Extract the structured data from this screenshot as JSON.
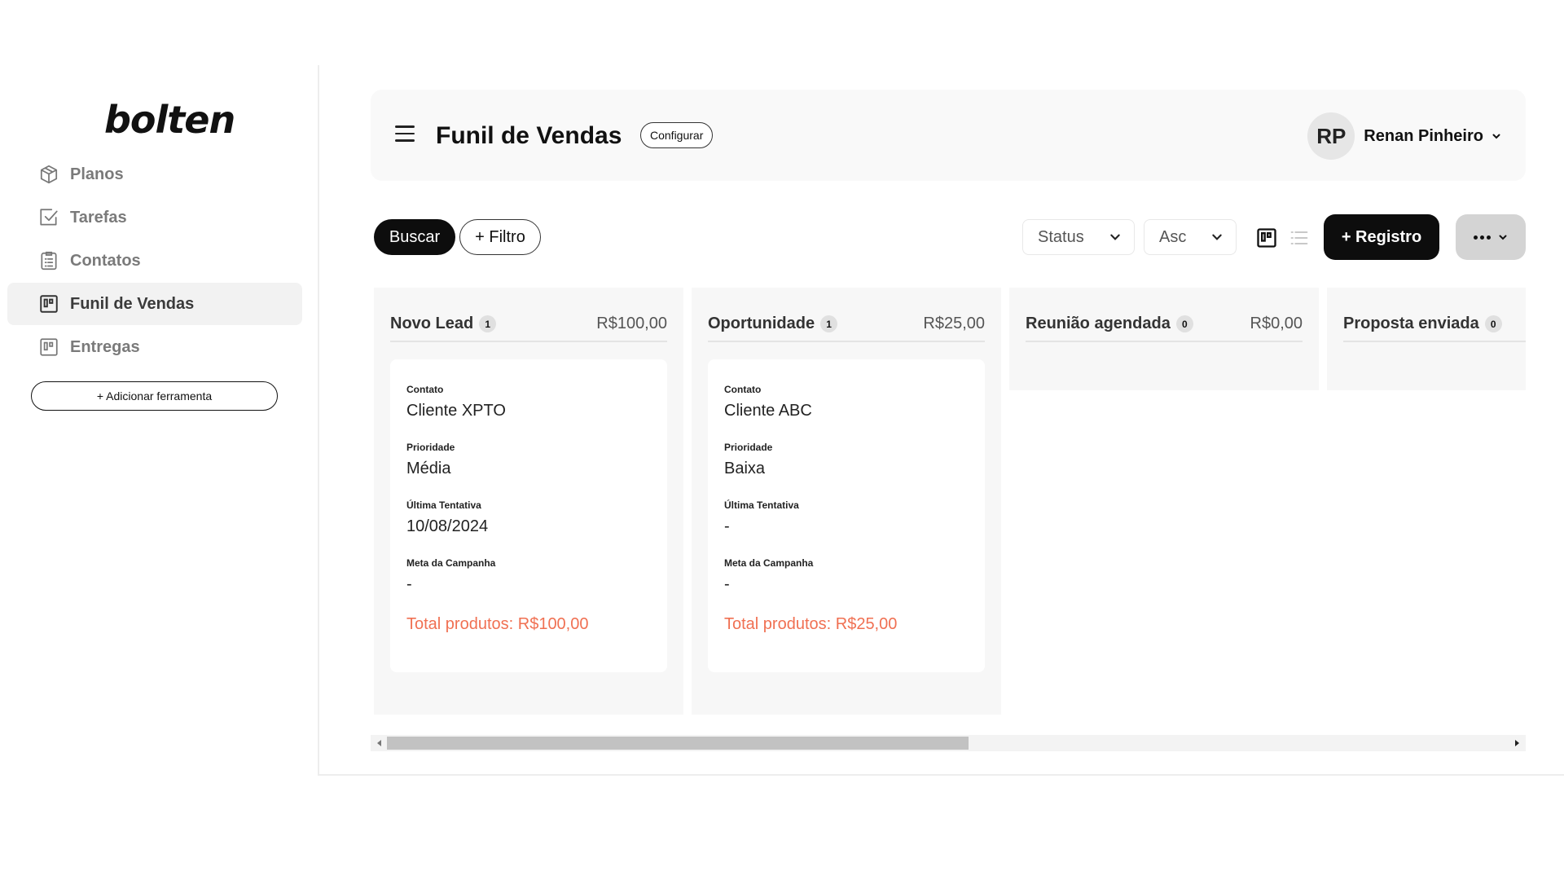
{
  "sidebar": {
    "logo": "bolten",
    "items": [
      {
        "label": "Planos",
        "icon": "box-icon",
        "active": false
      },
      {
        "label": "Tarefas",
        "icon": "checkbox-icon",
        "active": false
      },
      {
        "label": "Contatos",
        "icon": "clipboard-list-icon",
        "active": false
      },
      {
        "label": "Funil de Vendas",
        "icon": "kanban-icon",
        "active": true
      },
      {
        "label": "Entregas",
        "icon": "kanban-icon",
        "active": false
      }
    ],
    "add_tool_label": "+ Adicionar ferramenta"
  },
  "header": {
    "title": "Funil de Vendas",
    "config_label": "Configurar",
    "user": {
      "initials": "RP",
      "name": "Renan Pinheiro"
    }
  },
  "toolbar": {
    "search_label": "Buscar",
    "filter_label": "+ Filtro",
    "status_select": "Status",
    "order_select": "Asc",
    "add_record_label": "+ Registro"
  },
  "columns": [
    {
      "name": "Novo Lead",
      "count": "1",
      "total": "R$100,00",
      "cards": [
        {
          "fields": [
            {
              "label": "Contato",
              "value": "Cliente XPTO"
            },
            {
              "label": "Prioridade",
              "value": "Média"
            },
            {
              "label": "Última Tentativa",
              "value": "10/08/2024"
            },
            {
              "label": "Meta da Campanha",
              "value": "-"
            }
          ],
          "total": "Total produtos: R$100,00"
        }
      ]
    },
    {
      "name": "Oportunidade",
      "count": "1",
      "total": "R$25,00",
      "cards": [
        {
          "fields": [
            {
              "label": "Contato",
              "value": "Cliente ABC"
            },
            {
              "label": "Prioridade",
              "value": "Baixa"
            },
            {
              "label": "Última Tentativa",
              "value": "-"
            },
            {
              "label": "Meta da Campanha",
              "value": "-"
            }
          ],
          "total": "Total produtos: R$25,00"
        }
      ]
    },
    {
      "name": "Reunião agendada",
      "count": "0",
      "total": "R$0,00",
      "cards": []
    },
    {
      "name": "Proposta enviada",
      "count": "0",
      "total": "",
      "cards": []
    }
  ],
  "colors": {
    "primary": "#0d0d0d",
    "accent_total": "#f07052",
    "column_bg": "#f7f7f7",
    "active_nav_bg": "#f2f2f2"
  }
}
